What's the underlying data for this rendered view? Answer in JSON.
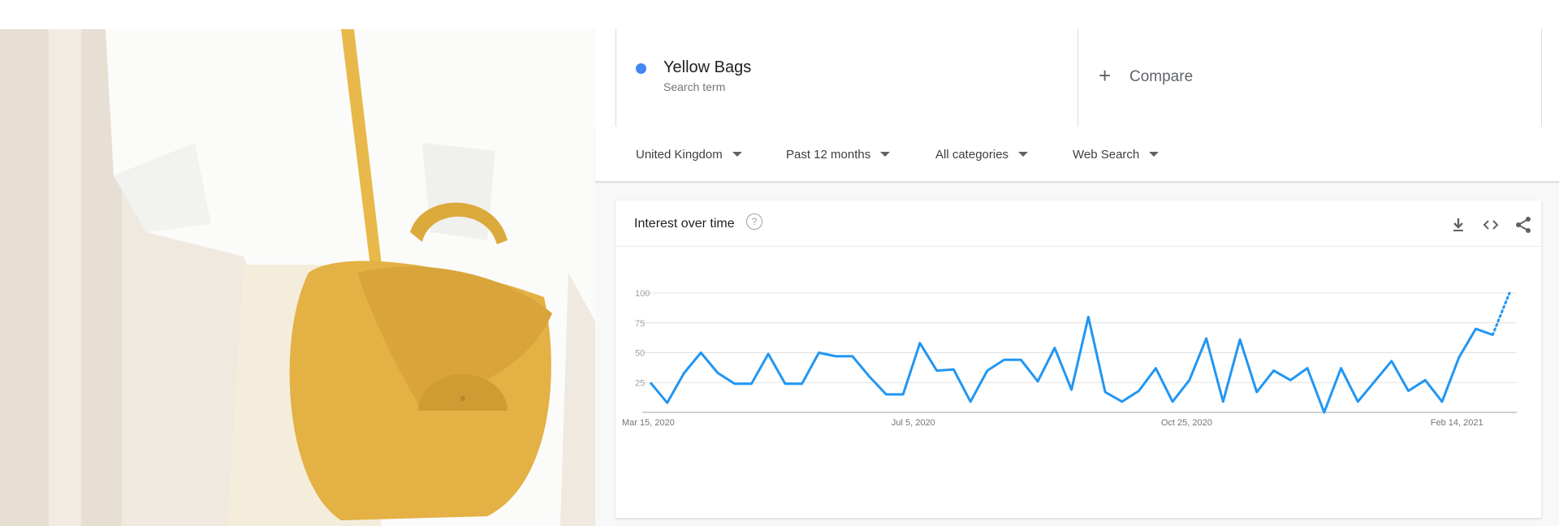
{
  "term": {
    "name": "Yellow Bags",
    "subtitle": "Search term",
    "color": "#4285f4"
  },
  "compare": {
    "label": "Compare",
    "icon": "plus-icon"
  },
  "filters": [
    {
      "label": "United Kingdom",
      "icon": "caret-down-icon"
    },
    {
      "label": "Past 12 months",
      "icon": "caret-down-icon"
    },
    {
      "label": "All categories",
      "icon": "caret-down-icon"
    },
    {
      "label": "Web Search",
      "icon": "caret-down-icon"
    }
  ],
  "card": {
    "title": "Interest over time",
    "help_icon": "help-circle-icon",
    "help_glyph": "?",
    "actions": [
      "download-icon",
      "embed-code-icon",
      "share-icon"
    ]
  },
  "chart_data": {
    "type": "line",
    "title": "Interest over time",
    "series_color": "#2196f3",
    "ylim": [
      0,
      100
    ],
    "yticks": [
      "100",
      "75",
      "50",
      "25"
    ],
    "xtick_labels": [
      {
        "index": 0,
        "label": "Mar 15, 2020"
      },
      {
        "index": 16,
        "label": "Jul 5, 2020"
      },
      {
        "index": 32,
        "label": "Oct 25, 2020"
      },
      {
        "index": 48,
        "label": "Feb 14, 2021"
      }
    ],
    "grid": true,
    "partial_last_point": true,
    "values": [
      25,
      8,
      33,
      50,
      33,
      24,
      24,
      49,
      24,
      24,
      50,
      47,
      47,
      30,
      15,
      15,
      58,
      35,
      36,
      9,
      35,
      44,
      44,
      26,
      54,
      19,
      80,
      17,
      9,
      18,
      37,
      9,
      27,
      62,
      9,
      61,
      17,
      35,
      27,
      37,
      0,
      37,
      9,
      26,
      43,
      18,
      27,
      9,
      46,
      70,
      65,
      100
    ]
  }
}
